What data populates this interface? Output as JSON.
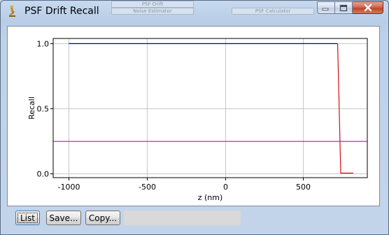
{
  "window": {
    "title": "PSF Drift Recall",
    "background_windows": [
      "PSF Drift",
      "Noise Estimator",
      "PSF Calculator"
    ]
  },
  "titlebar_buttons": {
    "minimize": "minimize-icon",
    "maximize": "maximize-icon",
    "close": "close-icon"
  },
  "chart_data": {
    "type": "line",
    "title": "",
    "xlabel": "z (nm)",
    "ylabel": "Recall",
    "xlim": [
      -1100,
      910
    ],
    "ylim": [
      -0.035,
      1.04
    ],
    "xticks": [
      -1000,
      -500,
      0,
      500
    ],
    "xtick_labels": [
      "-1000",
      "-500",
      "0",
      "500"
    ],
    "yticks": [
      0.0,
      0.5,
      1.0
    ],
    "ytick_labels": [
      "0.0",
      "0.5",
      "1.0"
    ],
    "grid": true,
    "series": [
      {
        "color": "#0000aa",
        "x": [
          -1000,
          720
        ],
        "y": [
          1.0,
          1.0
        ]
      },
      {
        "color": "#d01010",
        "x": [
          720,
          740,
          820
        ],
        "y": [
          1.0,
          0.0,
          0.0
        ]
      },
      {
        "color": "#d100d1",
        "x": [
          -1100,
          910
        ],
        "y": [
          0.245,
          0.245
        ]
      }
    ]
  },
  "buttons": {
    "list": "List",
    "save": "Save...",
    "copy": "Copy..."
  },
  "status_text": ""
}
